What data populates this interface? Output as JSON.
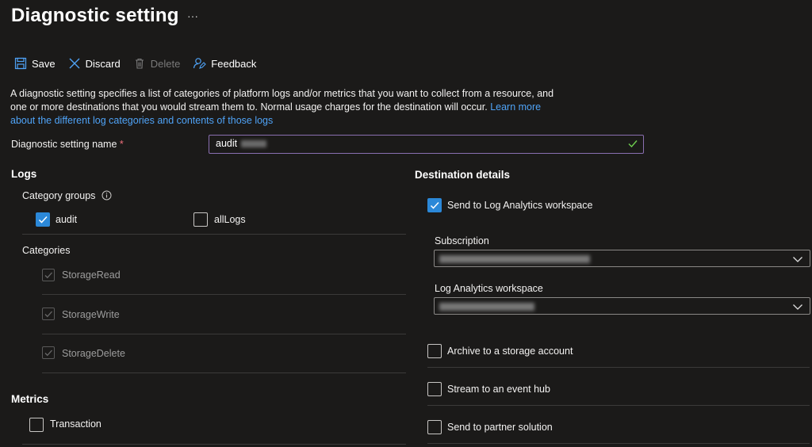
{
  "header": {
    "title": "Diagnostic setting",
    "more": "···"
  },
  "toolbar": {
    "save": "Save",
    "discard": "Discard",
    "delete": "Delete",
    "feedback": "Feedback"
  },
  "description": {
    "text": "A diagnostic setting specifies a list of categories of platform logs and/or metrics that you want to collect from a resource, and one or more destinations that you would stream them to. Normal usage charges for the destination will occur.",
    "link_text": "Learn more about the different log categories and contents of those logs"
  },
  "name_field": {
    "label": "Diagnostic setting name",
    "required_mark": "*",
    "value": "audit"
  },
  "logs": {
    "heading": "Logs",
    "category_groups_label": "Category groups",
    "groups": [
      {
        "label": "audit",
        "checked": true
      },
      {
        "label": "allLogs",
        "checked": false
      }
    ],
    "categories_label": "Categories",
    "categories": [
      {
        "label": "StorageRead",
        "checked": true
      },
      {
        "label": "StorageWrite",
        "checked": true
      },
      {
        "label": "StorageDelete",
        "checked": true
      }
    ]
  },
  "metrics": {
    "heading": "Metrics",
    "items": [
      {
        "label": "Transaction",
        "checked": false
      }
    ]
  },
  "destination": {
    "heading": "Destination details",
    "log_analytics": {
      "label": "Send to Log Analytics workspace",
      "checked": true
    },
    "subscription_label": "Subscription",
    "workspace_label": "Log Analytics workspace",
    "archive": {
      "label": "Archive to a storage account",
      "checked": false
    },
    "event_hub": {
      "label": "Stream to an event hub",
      "checked": false
    },
    "partner": {
      "label": "Send to partner solution",
      "checked": false
    }
  },
  "colors": {
    "background": "#1b1a19",
    "accent": "#2b88d8",
    "link": "#4fa3f7",
    "focus_border": "#8a6fb1",
    "valid_check": "#6fcf4f"
  }
}
